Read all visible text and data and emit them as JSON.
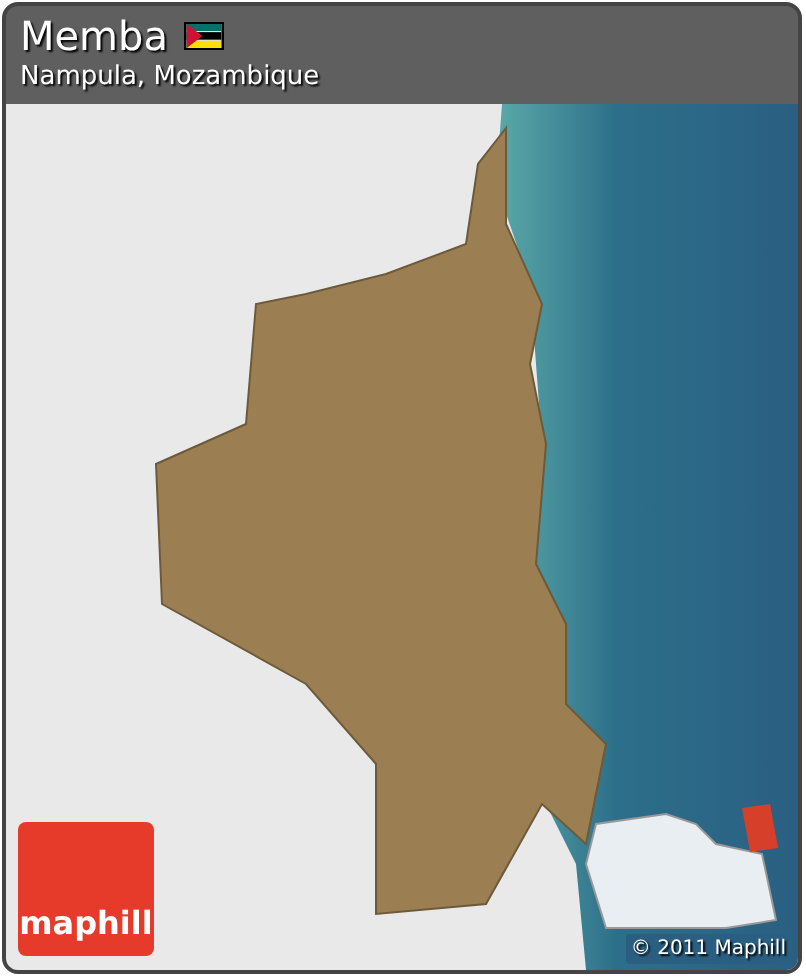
{
  "header": {
    "title": "Memba",
    "subtitle": "Nampula, Mozambique"
  },
  "logo": {
    "label": "maphill"
  },
  "copyright": "© 2011 Maphill"
}
